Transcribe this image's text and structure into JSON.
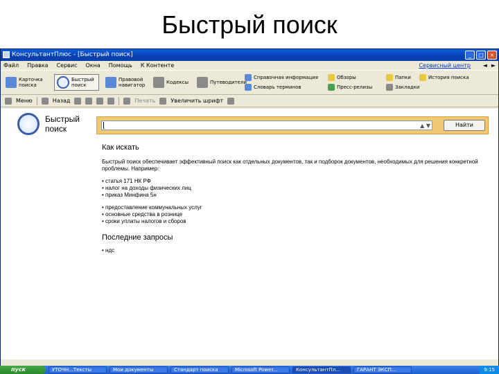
{
  "slide": {
    "title": "Быстрый поиск"
  },
  "window": {
    "title": "КонсультантПлюс - [Быстрый поиск]",
    "controls": {
      "minimize": "_",
      "maximize": "□",
      "close": "×"
    }
  },
  "menubar": {
    "items": [
      "Файл",
      "Правка",
      "Сервис",
      "Окна",
      "Помощь",
      "К Контенте"
    ],
    "right_link": "Сервисный центр",
    "back": "◄",
    "forward": "►"
  },
  "toolbar1": {
    "buttons": [
      {
        "label": "Карточка поиска",
        "icon": "card-search-icon"
      },
      {
        "label": "Быстрый поиск",
        "icon": "quick-search-icon",
        "active": true
      },
      {
        "label": "Правовой навигатор",
        "icon": "navigator-icon"
      },
      {
        "label": "Кодексы",
        "icon": "codex-icon"
      },
      {
        "label": "Путеводители",
        "icon": "guide-icon"
      }
    ],
    "group2": [
      "Справочная информация",
      "Словарь терминов"
    ],
    "group3": [
      "Обзоры",
      "Пресс-релизы"
    ],
    "group4": [
      "Папки",
      "Закладки"
    ],
    "group5": [
      "История поиска"
    ]
  },
  "toolbar2": {
    "menu": "Меню",
    "back": "Назад",
    "print_label": "Печать",
    "zoom_label": "Увеличить шрифт"
  },
  "quick_search": {
    "title_line1": "Быстрый",
    "title_line2": "поиск",
    "input_value": "",
    "input_tools": "▲ ▼",
    "find_button": "Найти"
  },
  "help": {
    "heading": "Как искать",
    "paragraph": "Быстрый поиск обеспечивает эффективный поиск как отдельных документов, так и подборок документов, необходимых для решения конкретной проблемы. Например:",
    "examples_group1": [
      "статья 171 НК РФ",
      "налог на доходы физических лиц",
      "приказ Минфина 5н"
    ],
    "examples_group2": [
      "предоставление коммунальных услуг",
      "основные средства в рознице",
      "сроки уплаты налогов и сборов"
    ],
    "recent_heading": "Последние запросы",
    "recent": [
      "ндс"
    ]
  },
  "taskbar": {
    "start": "пуск",
    "tasks": [
      "УТОЧН...Тексты",
      "Мои документы",
      "Стандарт поиска",
      "Microsoft Power...",
      "КонсультантПл...",
      "ГАРАНТ ЭКСП..."
    ],
    "active_index": 4,
    "tray_time": "9:15"
  }
}
